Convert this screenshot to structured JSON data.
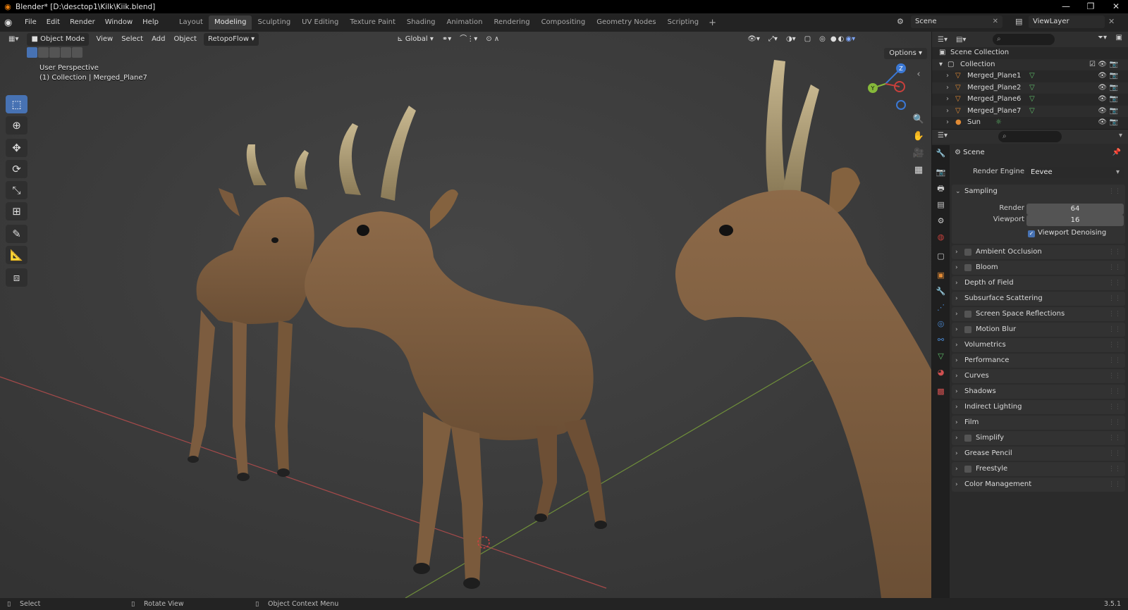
{
  "window": {
    "title": "Blender* [D:\\desktop1\\Kilk\\Kiik.blend]",
    "title_display": "Blender* [D:\\desctop1\\Kilk\\Kiik.blend]"
  },
  "menubar": {
    "menus": [
      "File",
      "Edit",
      "Render",
      "Window",
      "Help"
    ],
    "workspaces": [
      "Layout",
      "Modeling",
      "Sculpting",
      "UV Editing",
      "Texture Paint",
      "Shading",
      "Animation",
      "Rendering",
      "Compositing",
      "Geometry Nodes",
      "Scripting"
    ],
    "active_workspace": "Modeling",
    "scene": "Scene",
    "view_layer": "ViewLayer"
  },
  "viewport": {
    "mode": "Object Mode",
    "menus": [
      "View",
      "Select",
      "Add",
      "Object"
    ],
    "addon": "RetopoFlow",
    "orientation": "Global",
    "options_label": "Options",
    "info_line1": "User Perspective",
    "info_line2": "(1) Collection | Merged_Plane7",
    "axes": {
      "x": "X",
      "y": "Y",
      "z": "Z"
    }
  },
  "outliner": {
    "root": "Scene Collection",
    "collection": "Collection",
    "objects": [
      "Merged_Plane1",
      "Merged_Plane2",
      "Merged_Plane6",
      "Merged_Plane7",
      "Sun"
    ]
  },
  "properties": {
    "context": "Scene",
    "render_engine_label": "Render Engine",
    "render_engine": "Eevee",
    "sampling": {
      "title": "Sampling",
      "render_label": "Render",
      "render_value": "64",
      "viewport_label": "Viewport",
      "viewport_value": "16",
      "denoise_label": "Viewport Denoising"
    },
    "panels": [
      {
        "name": "Ambient Occlusion",
        "checkbox": true
      },
      {
        "name": "Bloom",
        "checkbox": true
      },
      {
        "name": "Depth of Field",
        "checkbox": false
      },
      {
        "name": "Subsurface Scattering",
        "checkbox": false
      },
      {
        "name": "Screen Space Reflections",
        "checkbox": true
      },
      {
        "name": "Motion Blur",
        "checkbox": true
      },
      {
        "name": "Volumetrics",
        "checkbox": false
      },
      {
        "name": "Performance",
        "checkbox": false
      },
      {
        "name": "Curves",
        "checkbox": false
      },
      {
        "name": "Shadows",
        "checkbox": false
      },
      {
        "name": "Indirect Lighting",
        "checkbox": false
      },
      {
        "name": "Film",
        "checkbox": false
      },
      {
        "name": "Simplify",
        "checkbox": true
      },
      {
        "name": "Grease Pencil",
        "checkbox": false
      },
      {
        "name": "Freestyle",
        "checkbox": true
      },
      {
        "name": "Color Management",
        "checkbox": false
      }
    ]
  },
  "statusbar": {
    "select": "Select",
    "rotate": "Rotate View",
    "context_menu": "Object Context Menu",
    "version": "3.5.1"
  },
  "colors": {
    "accent": "#4772b3",
    "object_orange": "#e08a35",
    "mesh_green": "#5fbf6a",
    "axis_x": "#c9403c",
    "axis_y": "#86b93a",
    "axis_z": "#3b78d4"
  }
}
